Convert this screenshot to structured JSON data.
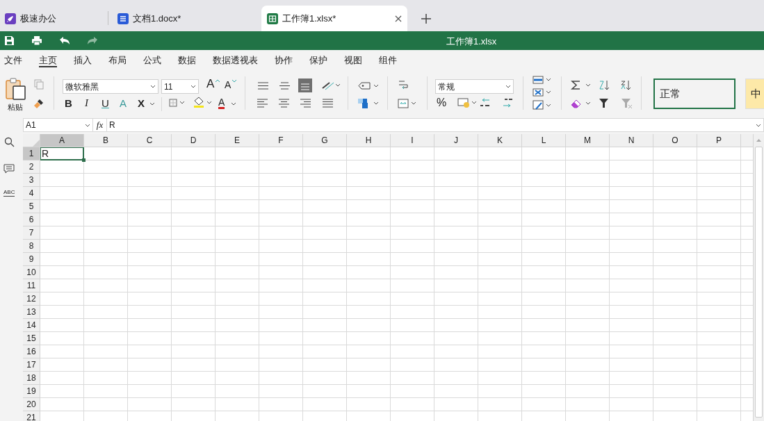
{
  "tabs": [
    {
      "kind": "app",
      "label": "极速办公",
      "selected": false
    },
    {
      "kind": "doc",
      "label": "文档1.docx*",
      "selected": false
    },
    {
      "kind": "sheet",
      "label": "工作簿1.xlsx*",
      "selected": true
    }
  ],
  "title_bar": {
    "title": "工作簿1.xlsx"
  },
  "menu": [
    {
      "label": "文件",
      "selected": false
    },
    {
      "label": "主页",
      "selected": true
    },
    {
      "label": "插入",
      "selected": false
    },
    {
      "label": "布局",
      "selected": false
    },
    {
      "label": "公式",
      "selected": false
    },
    {
      "label": "数据",
      "selected": false
    },
    {
      "label": "数据透视表",
      "selected": false
    },
    {
      "label": "协作",
      "selected": false
    },
    {
      "label": "保护",
      "selected": false
    },
    {
      "label": "视图",
      "selected": false
    },
    {
      "label": "组件",
      "selected": false
    }
  ],
  "ribbon": {
    "paste_label": "粘贴",
    "font": "微软雅黑",
    "font_size": "11",
    "grow_font": "A",
    "shrink_font": "A",
    "bold": "B",
    "italic": "I",
    "underline": "U",
    "text_effect": "A",
    "subscript": "X",
    "font_color": "A",
    "percent": "%",
    "number_format": "常规",
    "styles": [
      {
        "label": "正常",
        "selected": true
      },
      {
        "label": "中",
        "selected": false
      }
    ]
  },
  "formula_bar": {
    "name_box": "A1",
    "fx": "fx",
    "value": "R"
  },
  "sidebar": {
    "spellcheck": "ABC"
  },
  "sheet": {
    "columns": [
      {
        "label": "A",
        "selected": true
      },
      {
        "label": "B",
        "selected": false
      },
      {
        "label": "C",
        "selected": false
      },
      {
        "label": "D",
        "selected": false
      },
      {
        "label": "E",
        "selected": false
      },
      {
        "label": "F",
        "selected": false
      },
      {
        "label": "G",
        "selected": false
      },
      {
        "label": "H",
        "selected": false
      },
      {
        "label": "I",
        "selected": false
      },
      {
        "label": "J",
        "selected": false
      },
      {
        "label": "K",
        "selected": false
      },
      {
        "label": "L",
        "selected": false
      },
      {
        "label": "M",
        "selected": false
      },
      {
        "label": "N",
        "selected": false
      },
      {
        "label": "O",
        "selected": false
      },
      {
        "label": "P",
        "selected": false
      }
    ],
    "rows": [
      {
        "label": "1",
        "selected": true,
        "values": [
          "R"
        ]
      },
      {
        "label": "2",
        "selected": false
      },
      {
        "label": "3",
        "selected": false
      },
      {
        "label": "4",
        "selected": false
      },
      {
        "label": "5",
        "selected": false
      },
      {
        "label": "6",
        "selected": false
      },
      {
        "label": "7",
        "selected": false
      },
      {
        "label": "8",
        "selected": false
      },
      {
        "label": "9",
        "selected": false
      },
      {
        "label": "10",
        "selected": false
      },
      {
        "label": "11",
        "selected": false
      },
      {
        "label": "12",
        "selected": false
      },
      {
        "label": "13",
        "selected": false
      },
      {
        "label": "14",
        "selected": false
      },
      {
        "label": "15",
        "selected": false
      },
      {
        "label": "16",
        "selected": false
      },
      {
        "label": "17",
        "selected": false
      },
      {
        "label": "18",
        "selected": false
      },
      {
        "label": "19",
        "selected": false
      },
      {
        "label": "20",
        "selected": false
      },
      {
        "label": "21",
        "selected": false
      }
    ]
  }
}
